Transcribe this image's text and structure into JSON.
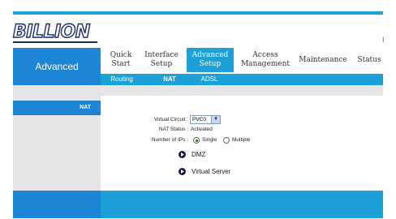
{
  "brand": {
    "logo_text": "BILLION",
    "corner_mark": "I"
  },
  "sidebar": {
    "section_title": "Advanced",
    "active_item": "NAT"
  },
  "nav": {
    "quick_start": "Quick Start",
    "interface_setup": "Interface Setup",
    "advanced_setup": "Advanced Setup",
    "access_management": "Access Management",
    "maintenance": "Maintenance",
    "status": "Status"
  },
  "subnav": {
    "routing": "Routing",
    "nat": "NAT",
    "adsl": "ADSL"
  },
  "form": {
    "virtual_circuit_label": "Virtual Circuit :",
    "virtual_circuit_value": "PVC0",
    "nat_status_label": "NAT Status :",
    "nat_status_value": "Activated",
    "number_of_ips_label": "Number of IPs :",
    "single_label": "Single",
    "multiple_label": "Multiple",
    "selected_ips": "Single"
  },
  "links": {
    "dmz": "DMZ",
    "virtual_server": "Virtual Server"
  },
  "colors": {
    "accent": "#1ba0d8",
    "sidebar_blue": "#1c85d6",
    "logo_navy": "#1a2b70",
    "panel_gray": "#e5e5e5"
  }
}
